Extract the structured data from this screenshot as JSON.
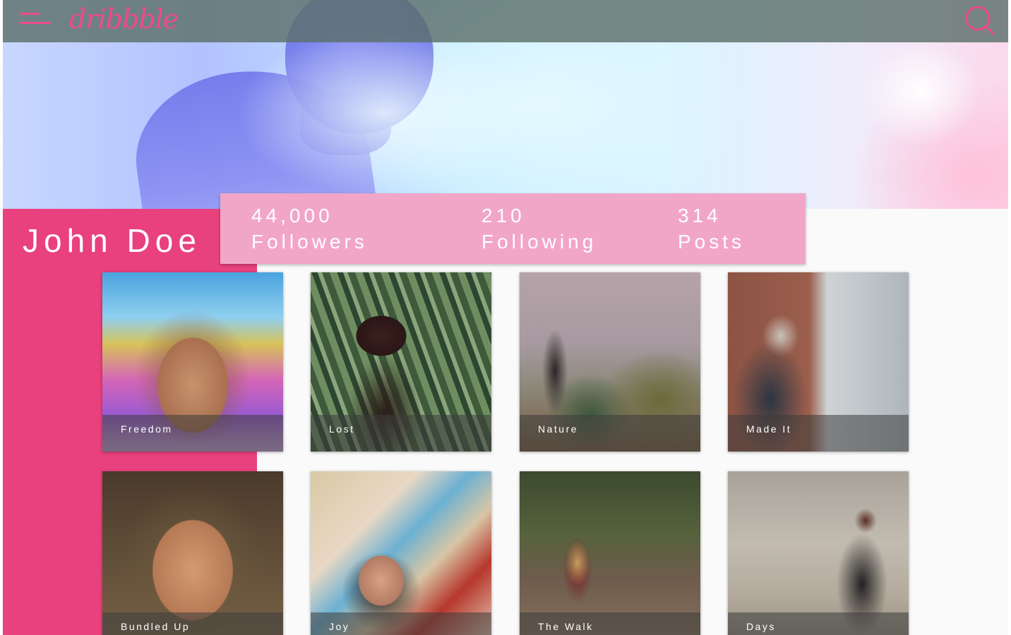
{
  "app": {
    "logo_text": "dribbble"
  },
  "topbar": {
    "menu_icon": "hamburger-menu-icon",
    "search_icon": "search-icon"
  },
  "profile": {
    "name": "John Doe",
    "stats": {
      "followers": {
        "value": "44,000",
        "label": "Followers"
      },
      "following": {
        "value": "210",
        "label": "Following"
      },
      "posts": {
        "value": "314",
        "label": "Posts"
      }
    }
  },
  "gallery": [
    {
      "caption": "Freedom"
    },
    {
      "caption": "Lost"
    },
    {
      "caption": "Nature"
    },
    {
      "caption": "Made It"
    },
    {
      "caption": "Bundled Up"
    },
    {
      "caption": "Joy"
    },
    {
      "caption": "The Walk"
    },
    {
      "caption": "Days"
    }
  ],
  "colors": {
    "accent": "#e9407e",
    "stats_card": "#f1a6c8",
    "topbar": "#5c706a"
  }
}
